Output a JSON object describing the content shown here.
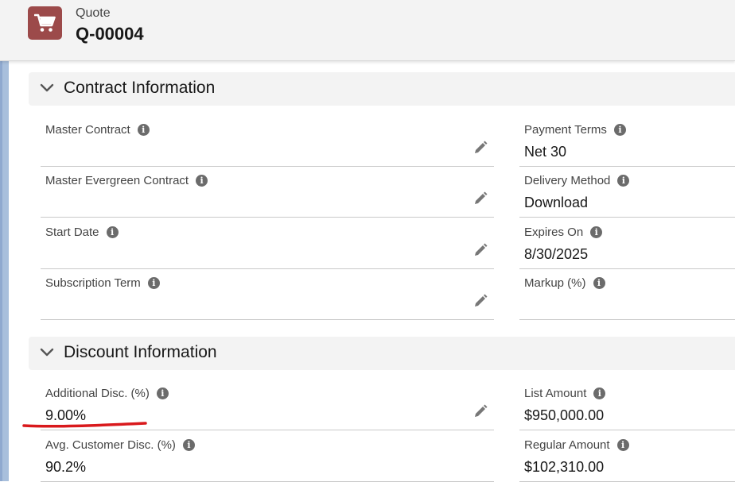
{
  "record": {
    "object_type": "Quote",
    "name": "Q-00004",
    "icon": "cart-icon",
    "icon_color": "#9c4a4a"
  },
  "sections": {
    "contract": {
      "title": "Contract Information",
      "left": [
        {
          "label": "Master Contract",
          "value": ""
        },
        {
          "label": "Master Evergreen Contract",
          "value": ""
        },
        {
          "label": "Start Date",
          "value": ""
        },
        {
          "label": "Subscription Term",
          "value": ""
        }
      ],
      "right": [
        {
          "label": "Payment Terms",
          "value": "Net 30"
        },
        {
          "label": "Delivery Method",
          "value": "Download"
        },
        {
          "label": "Expires On",
          "value": "8/30/2025"
        },
        {
          "label": "Markup (%)",
          "value": ""
        }
      ]
    },
    "discount": {
      "title": "Discount Information",
      "left": [
        {
          "label": "Additional Disc. (%)",
          "value": "9.00%"
        },
        {
          "label": "Avg. Customer Disc. (%)",
          "value": "90.2%"
        }
      ],
      "right": [
        {
          "label": "List Amount",
          "value": "$950,000.00"
        },
        {
          "label": "Regular Amount",
          "value": "$102,310.00"
        }
      ]
    }
  },
  "annotation": {
    "color": "#d9191c"
  }
}
